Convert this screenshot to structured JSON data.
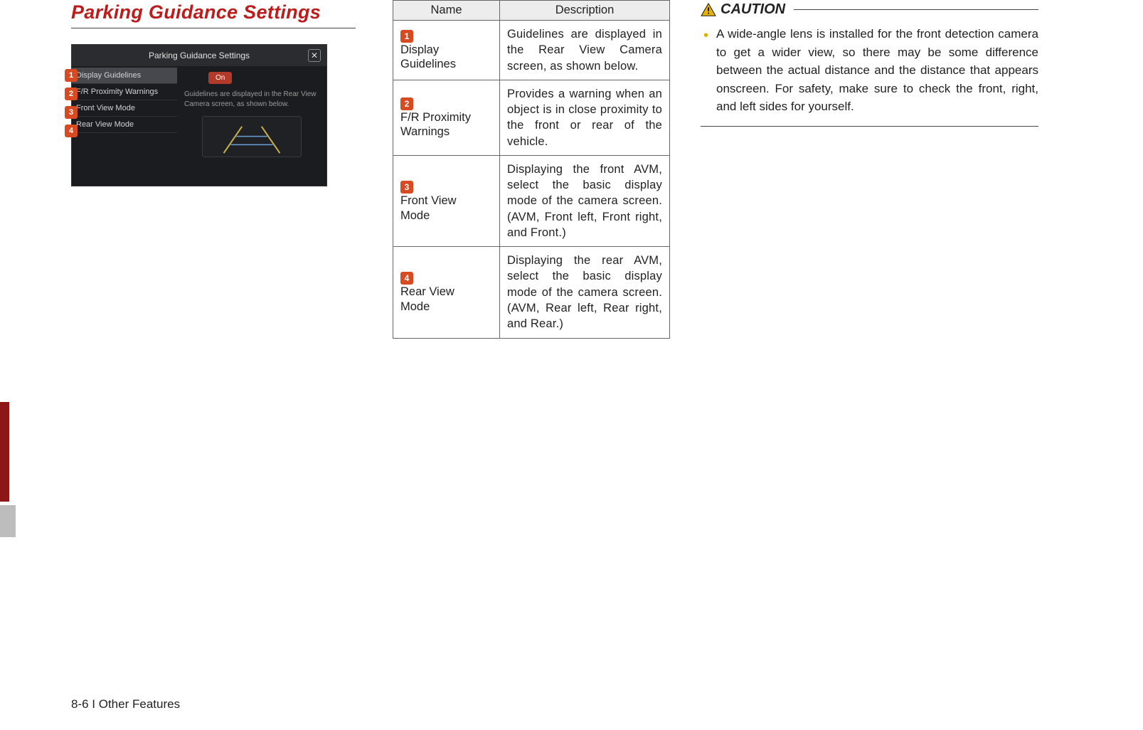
{
  "heading": "Parking Guidance Settings",
  "screenshot": {
    "title": "Parking Guidance Settings",
    "close_glyph": "✕",
    "on_label": "On",
    "desc": "Guidelines are displayed in the Rear View Camera screen, as shown below.",
    "menu": {
      "items": [
        {
          "num": "1",
          "label": "Display Guidelines",
          "selected": true
        },
        {
          "num": "2",
          "label": "F/R Proximity Warnings",
          "selected": false
        },
        {
          "num": "3",
          "label": "Front View Mode",
          "selected": false
        },
        {
          "num": "4",
          "label": "Rear View Mode",
          "selected": false
        }
      ]
    }
  },
  "table": {
    "headers": {
      "name": "Name",
      "desc": "Description"
    },
    "rows": [
      {
        "num": "1",
        "name": "Display Guidelines",
        "desc": "Guidelines are displayed in the Rear View Camera screen, as shown below."
      },
      {
        "num": "2",
        "name": "F/R Proximity Warnings",
        "desc": "Provides a warning when an object is in close proximity to the front or rear of the vehicle."
      },
      {
        "num": "3",
        "name": "Front View Mode",
        "desc": "Displaying the front AVM, select the basic display mode of the camera screen. (AVM, Front left, Front right, and Front.)"
      },
      {
        "num": "4",
        "name": "Rear View Mode",
        "desc": "Displaying the rear AVM, select the basic display mode of the camera screen. (AVM, Rear left, Rear right, and Rear.)"
      }
    ]
  },
  "caution": {
    "label": "CAUTION",
    "text": "A wide-angle lens is installed for the front detection camera to get a wider view, so there may be some difference between the actual distance and the distance that appears onscreen. For safety, make sure to check the front, right, and left sides for yourself."
  },
  "footer": "8-6 I Other Features"
}
